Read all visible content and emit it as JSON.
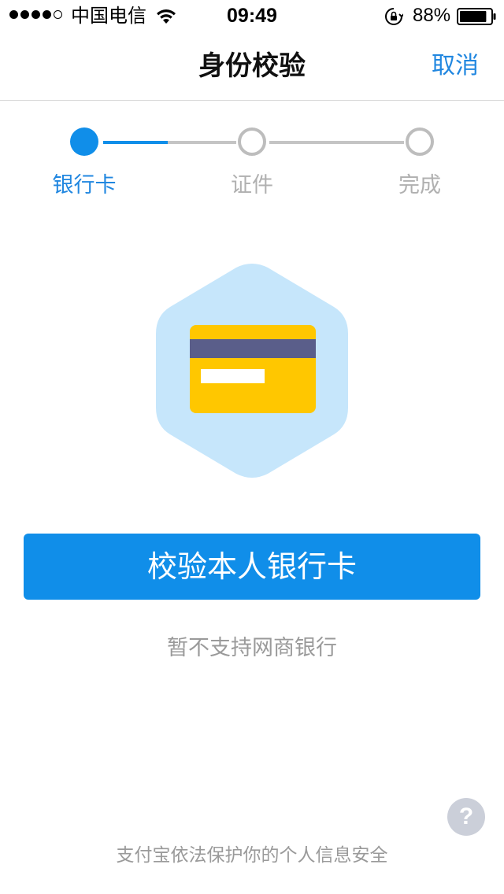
{
  "status_bar": {
    "carrier": "中国电信",
    "time": "09:49",
    "battery_percent": "88%",
    "signal_bars_filled": 4,
    "signal_bars_total": 5,
    "battery_level": 0.88
  },
  "nav": {
    "title": "身份校验",
    "cancel_label": "取消"
  },
  "steps": {
    "current_index": 0,
    "items": [
      {
        "label": "银行卡",
        "state": "active"
      },
      {
        "label": "证件",
        "state": "pending"
      },
      {
        "label": "完成",
        "state": "pending"
      }
    ]
  },
  "illustration": {
    "icon": "bank-card-icon",
    "hexagon_color": "#c6e6fb",
    "card_color": "#ffc700",
    "stripe_color": "#5a5e8a"
  },
  "main": {
    "verify_button_label": "校验本人银行卡",
    "note": "暂不支持网商银行"
  },
  "help": {
    "icon": "question-icon",
    "label": "?"
  },
  "footer": {
    "text": "支付宝依法保护你的个人信息安全"
  },
  "colors": {
    "accent": "#108ee9",
    "link": "#2187e0",
    "muted_text": "#9a9a9a",
    "inactive_step": "#bdbdbd"
  }
}
